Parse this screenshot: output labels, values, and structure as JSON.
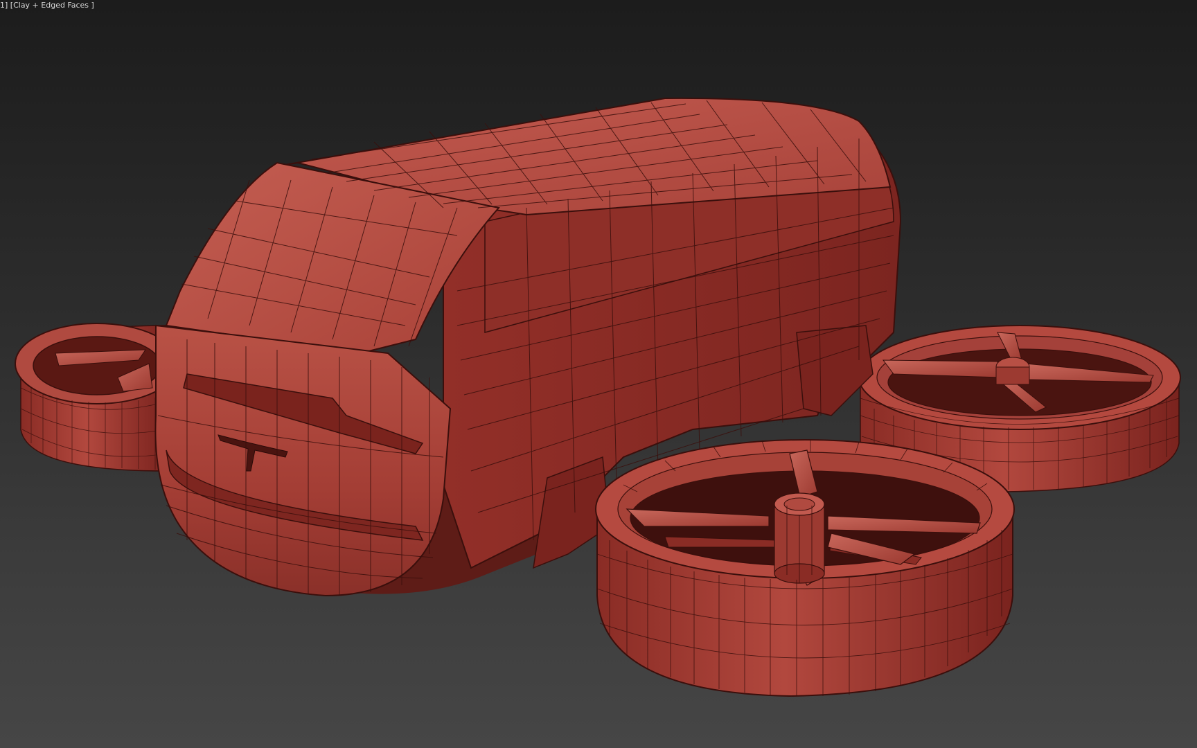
{
  "viewport": {
    "label": "1] [Clay + Edged Faces ]",
    "shading_mode": "Clay + Edged Faces",
    "background_top": "#1c1c1c",
    "background_bottom": "#464646"
  },
  "scene": {
    "subject": "eVTOL van body with four ducted fans",
    "clay_color": "#b4463c",
    "edge_color": "#3a0f0c",
    "icons": [
      "vehicle-body-mesh",
      "ducted-fan-mesh",
      "rotor-blade-mesh",
      "rotor-hub-mesh"
    ]
  }
}
